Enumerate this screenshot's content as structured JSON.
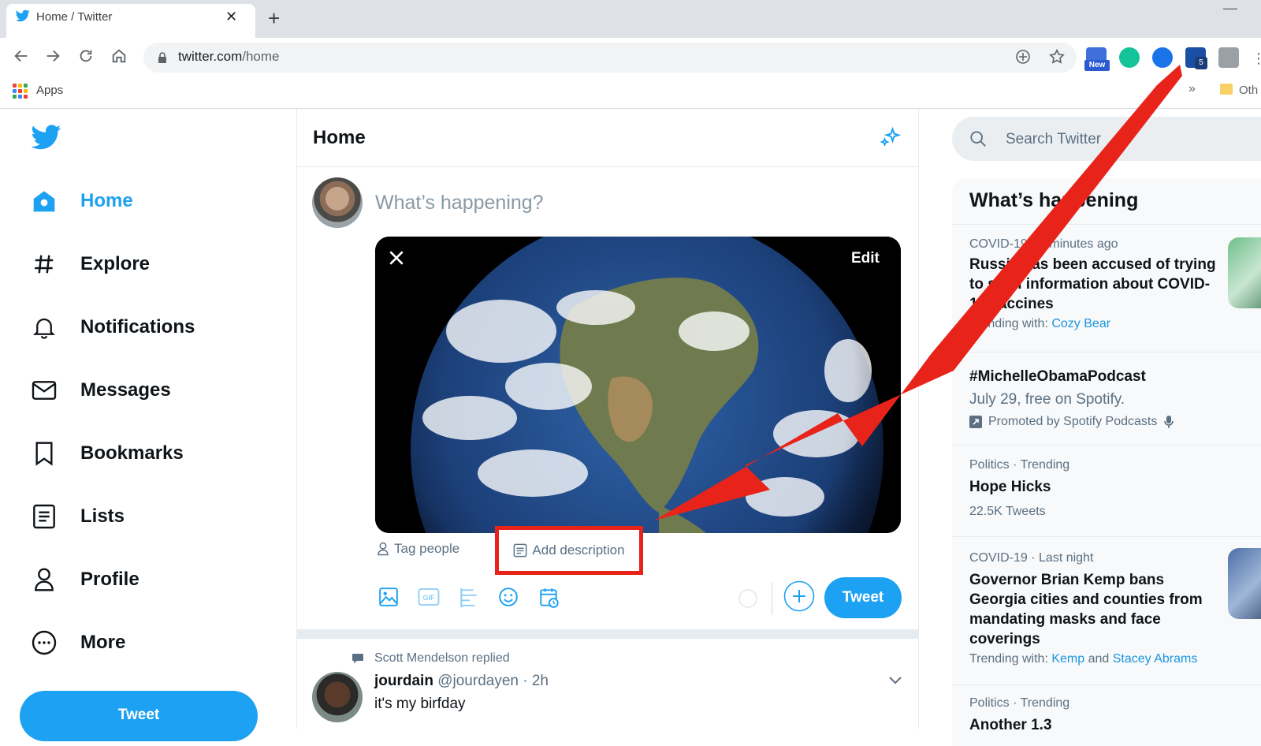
{
  "browser": {
    "tab_title": "Home / Twitter",
    "url_host": "twitter.com",
    "url_path": "/home",
    "bookmarks_apps": "Apps",
    "bookmarks_more": "»",
    "bookmarks_other": "Oth",
    "extension_new_badge": "New",
    "extension_count_badge": "5"
  },
  "nav": {
    "items": [
      {
        "label": "Home",
        "icon": "home-icon",
        "active": true
      },
      {
        "label": "Explore",
        "icon": "hashtag-icon"
      },
      {
        "label": "Notifications",
        "icon": "bell-icon"
      },
      {
        "label": "Messages",
        "icon": "envelope-icon"
      },
      {
        "label": "Bookmarks",
        "icon": "bookmark-icon"
      },
      {
        "label": "Lists",
        "icon": "list-icon"
      },
      {
        "label": "Profile",
        "icon": "person-icon"
      },
      {
        "label": "More",
        "icon": "more-dots-icon"
      }
    ],
    "tweet_button": "Tweet"
  },
  "main": {
    "title": "Home",
    "compose_placeholder": "What’s happening?",
    "media_edit": "Edit",
    "tag_people": "Tag people",
    "add_description": "Add description",
    "tweet_button": "Tweet",
    "toolbar_icons": [
      "image-icon",
      "gif-icon",
      "poll-icon",
      "emoji-icon",
      "schedule-icon"
    ]
  },
  "timeline": {
    "reply_context": "Scott Mendelson replied",
    "name": "jourdain",
    "handle_time": "@jourdayen · 2h",
    "text": "it's my birfday"
  },
  "right": {
    "search_placeholder": "Search Twitter",
    "trends_title": "What’s happening",
    "trends": [
      {
        "meta": "COVID-19 · 8 minutes ago",
        "title": "Russia has been accused of trying to steal information about COVID-19 vaccines",
        "sub_prefix": "Trending with: ",
        "links": [
          "Cozy Bear"
        ]
      },
      {
        "title": "#MichelleObamaPodcast",
        "sub": "July 29, free on Spotify.",
        "promoted": "Promoted by Spotify Podcasts"
      },
      {
        "meta": "Politics · Trending",
        "title": "Hope Hicks",
        "sub": "22.5K Tweets"
      },
      {
        "meta": "COVID-19 · Last night",
        "title": "Governor Brian Kemp bans Georgia cities and counties from mandating masks and face coverings",
        "sub_prefix": "Trending with: ",
        "links": [
          "Kemp",
          "Stacey Abrams"
        ],
        "joiner": " and "
      },
      {
        "meta": "Politics · Trending",
        "title": "Another 1.3"
      }
    ]
  },
  "colors": {
    "twitter_blue": "#1da1f2",
    "annotation_red": "#e8231a"
  }
}
